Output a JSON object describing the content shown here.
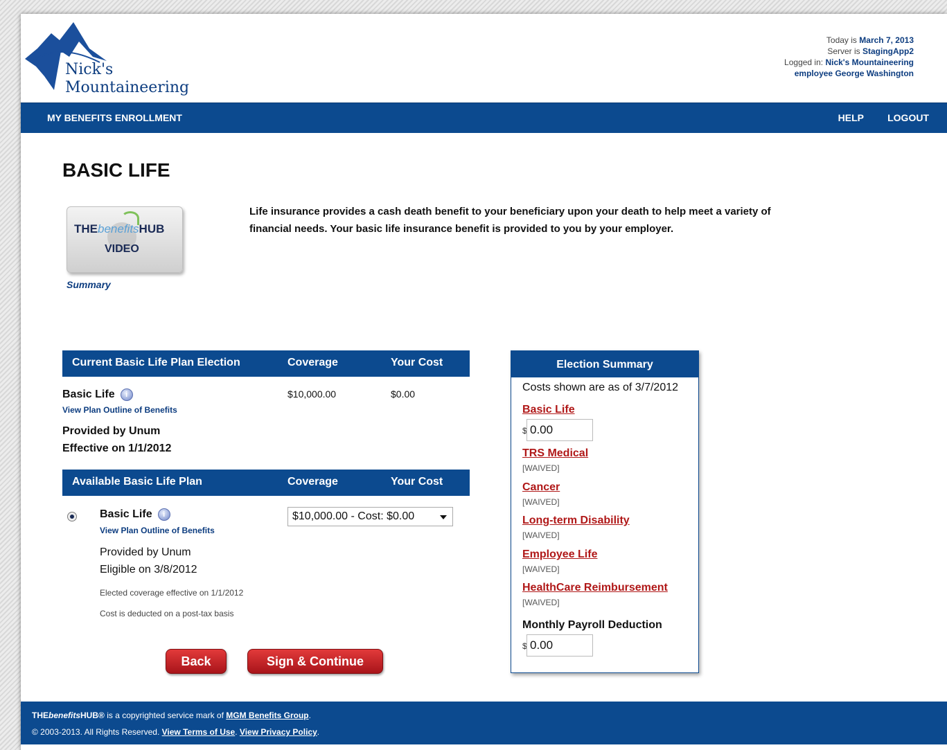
{
  "logo": {
    "line1": "Nick's",
    "line2": "Mountaineering"
  },
  "topinfo": {
    "today_label": "Today is",
    "today_value": "March 7, 2013",
    "server_label": "Server is",
    "server_value": "StagingApp2",
    "logged_label": "Logged in:",
    "logged_value": "Nick's Mountaineering",
    "employee_value": "employee George Washington"
  },
  "nav": {
    "title": "MY BENEFITS ENROLLMENT",
    "help": "HELP",
    "logout": "LOGOUT"
  },
  "page": {
    "title": "BASIC LIFE"
  },
  "video": {
    "hub_prefix": "THE",
    "hub_italic": "benefits",
    "hub_suffix": "HUB",
    "video_label": "VIDEO",
    "summary_link": "Summary"
  },
  "intro": "Life insurance provides a cash death benefit to your beneficiary upon your death to help meet a variety of financial needs. Your basic life insurance benefit is provided to you by your employer.",
  "current": {
    "headers": [
      "Current Basic Life Plan Election",
      "Coverage",
      "Your Cost"
    ],
    "plan": "Basic Life",
    "link": "View Plan Outline of Benefits",
    "coverage": "$10,000.00",
    "cost": "$0.00",
    "provider": "Provided by Unum",
    "effective": "Effective on 1/1/2012"
  },
  "available": {
    "headers": [
      "Available Basic Life Plan",
      "Coverage",
      "Your Cost"
    ],
    "plan": "Basic Life",
    "link": "View Plan Outline of Benefits",
    "provider": "Provided by Unum",
    "eligible": "Eligible on 3/8/2012",
    "elected_note": "Elected coverage effective on 1/1/2012",
    "tax_note": "Cost is deducted on a post-tax basis",
    "selected_option": "$10,000.00 - Cost: $0.00"
  },
  "buttons": {
    "back": "Back",
    "sign": "Sign & Continue"
  },
  "summary": {
    "title": "Election Summary",
    "note": "Costs shown are as of 3/7/2012",
    "basic_life": "Basic Life",
    "currency": "$",
    "basic_life_value": "0.00",
    "items": [
      {
        "label": "TRS Medical",
        "status": "[WAIVED]"
      },
      {
        "label": "Cancer",
        "status": "[WAIVED]"
      },
      {
        "label": "Long-term Disability",
        "status": "[WAIVED]"
      },
      {
        "label": "Employee Life",
        "status": "[WAIVED]"
      },
      {
        "label": "HealthCare Reimbursement",
        "status": "[WAIVED]"
      }
    ],
    "payroll_label": "Monthly Payroll Deduction",
    "payroll_value": "0.00"
  },
  "footer": {
    "brand_prefix": "THE",
    "brand_italic": "benefits",
    "brand_suffix": "HUB®",
    "mark_text": " is a copyrighted service mark of ",
    "company_link": "MGM Benefits Group",
    "copyright": "© 2003-2013.  All Rights Reserved.",
    "terms_link": "View Terms of Use",
    "privacy_link": "View Privacy Policy"
  }
}
